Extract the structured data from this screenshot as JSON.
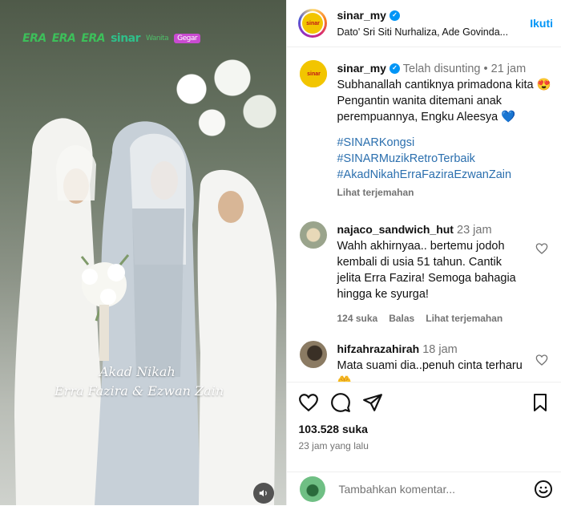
{
  "media": {
    "logos": [
      "ERA",
      "ERA",
      "ERA",
      "sinar",
      "Wanita",
      "Gegar"
    ],
    "overlay_line1": "Akad Nikah",
    "overlay_line2": "Erra Fazira & Ezwan Zain"
  },
  "header": {
    "username": "sinar_my",
    "avatar_text": "sinar",
    "subtitle": "Dato' Sri Siti Nurhaliza, Ade Govinda...",
    "follow_label": "Ikuti"
  },
  "caption": {
    "username": "sinar_my",
    "edited_label": "Telah disunting",
    "time": "21 jam",
    "text": "Subhanallah cantiknya primadona kita 😍 Pengantin wanita ditemani anak perempuannya, Engku Aleesya 💙",
    "hashtags": [
      "#SINARKongsi",
      "#SINARMuzikRetroTerbaik",
      "#AkadNikahErraFaziraEzwanZain"
    ],
    "translate_label": "Lihat terjemahan"
  },
  "comments": [
    {
      "username": "najaco_sandwich_hut",
      "time": "23 jam",
      "text": "Wahh akhirnyaa.. bertemu jodoh kembali di usia 51 tahun. Cantik jelita Erra Fazira! Semoga bahagia hingga ke syurga!",
      "likes": "124 suka",
      "reply_label": "Balas",
      "translate_label": "Lihat terjemahan"
    },
    {
      "username": "hifzahrazahirah",
      "time": "18 jam",
      "text": "Mata suami dia..penuh cinta terharu 🤲"
    }
  ],
  "actions": {
    "likes": "103.528 suka",
    "time_ago": "23 jam yang lalu"
  },
  "add_comment": {
    "placeholder": "Tambahkan komentar..."
  },
  "colors": {
    "accent": "#0095f6",
    "hashtag": "#2b6fae",
    "muted": "#737373"
  }
}
